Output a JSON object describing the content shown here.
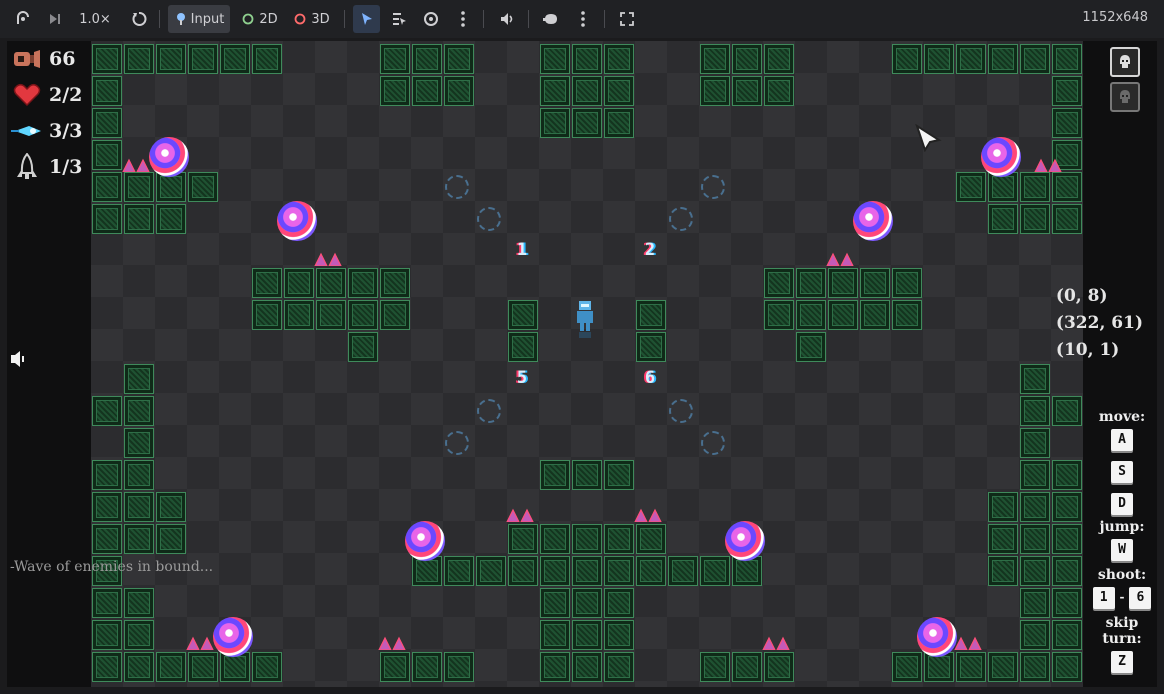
{
  "toolbar": {
    "speed": "1.0×",
    "input_label": "Input",
    "view2d_label": "2D",
    "view3d_label": "3D",
    "resolution": "1152x648"
  },
  "hud": {
    "ammo": "66",
    "health": "2/2",
    "dash": "3/3",
    "lives": "1/3",
    "message": "-Wave of enemies in bound..."
  },
  "coords": [
    "(0, 8)",
    "(322, 61)",
    "(10, 1)"
  ],
  "controls": {
    "move_label": "move:",
    "move_keys": [
      "A",
      "S",
      "D"
    ],
    "jump_label": "jump:",
    "jump_key": "W",
    "shoot_label": "shoot:",
    "shoot_from": "1",
    "shoot_sep": "-",
    "shoot_to": "6",
    "skip_label_1": "skip",
    "skip_label_2": "turn:",
    "skip_key": "Z"
  },
  "slots": [
    "1",
    "2",
    "5",
    "6"
  ],
  "colors": {
    "tile": "#14351f",
    "tile_border": "#3f8a5b",
    "accent_red": "#ff3b6b",
    "accent_blue": "#2ab8ff"
  }
}
